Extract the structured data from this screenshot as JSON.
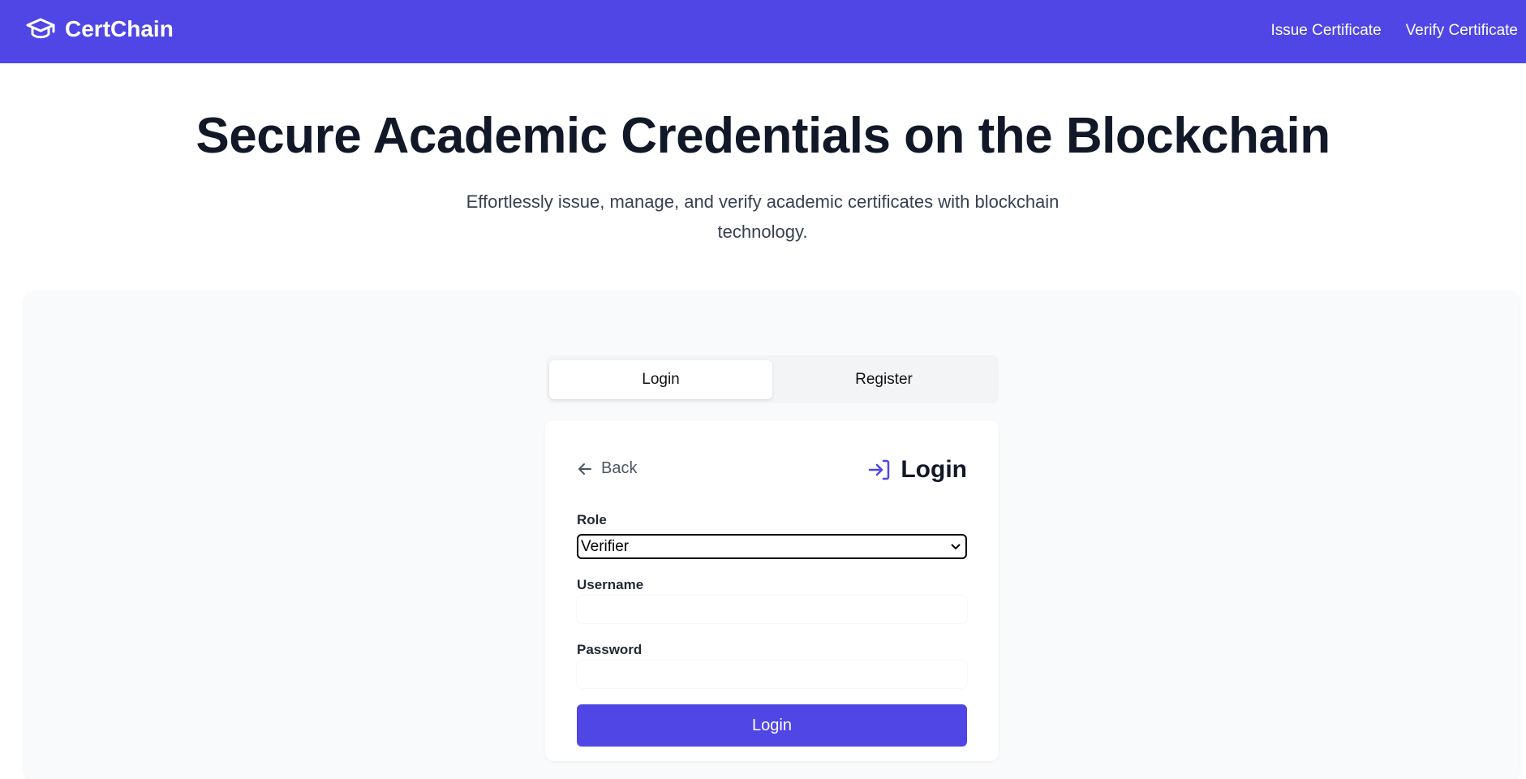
{
  "navbar": {
    "brand": "CertChain",
    "brand_icon": "graduation-cap-icon",
    "links": [
      "Issue Certificate",
      "Verify Certificate"
    ],
    "color": "#4f46e5"
  },
  "hero": {
    "title": "Secure Academic Credentials on the Blockchain",
    "subtitle": "Effortlessly issue, manage, and verify academic certificates with blockchain technology."
  },
  "tabs": [
    {
      "label": "Login",
      "active": true
    },
    {
      "label": "Register",
      "active": false
    }
  ],
  "login_card": {
    "back_label": "Back",
    "title": "Login",
    "role_label": "Role",
    "role_value": "Verifier",
    "username_label": "Username",
    "username_value": "",
    "password_label": "Password",
    "password_value": "",
    "submit_label": "Login"
  }
}
